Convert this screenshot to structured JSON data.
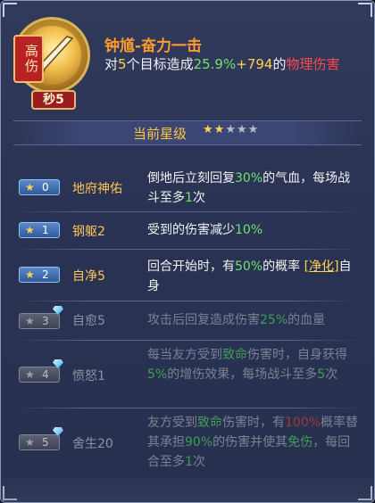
{
  "skill": {
    "type_badge": "高伤",
    "cast_badge": "秒5",
    "title": "钟馗-奋力一击",
    "desc_prefix": "对",
    "target_count": "5",
    "desc_mid": "个目标造成",
    "pct": "25.9%",
    "plus": "+",
    "flat": "794",
    "desc_of": "的",
    "damage_type": "物理伤害"
  },
  "level": {
    "label": "当前星级",
    "stars_filled": 2,
    "stars_total": 5,
    "stars_text_on": "★★",
    "stars_text_off": "★★★"
  },
  "colors": {
    "accent_orange": "#ff9a2e",
    "value_yellow": "#ffd24a",
    "value_green": "#6fe36a",
    "damage_red": "#ff4a4a"
  },
  "rows": [
    {
      "star": "★",
      "num": "0",
      "name": "地府神佑",
      "locked": false,
      "parts": [
        "倒地后立刻回复",
        "30%",
        "的气血，每场战斗至多",
        "1",
        "次"
      ]
    },
    {
      "star": "★",
      "num": "1",
      "name": "钢躯2",
      "locked": false,
      "parts": [
        "受到的伤害减少",
        "10%"
      ]
    },
    {
      "star": "★",
      "num": "2",
      "name": "自净5",
      "locked": false,
      "parts": [
        "回合开始时，有",
        "50%",
        "的概率 ",
        "[净化]",
        "自身"
      ]
    },
    {
      "star": "★",
      "num": "3",
      "name": "自愈5",
      "locked": true,
      "parts": [
        "攻击后回复造成伤害",
        "25%",
        "的血量"
      ]
    },
    {
      "star": "★",
      "num": "4",
      "name": "愤怒1",
      "locked": true,
      "parts": [
        "每当友方受到",
        "致命",
        "伤害时，自身获得",
        "5%",
        "的增伤效果，每场战斗至多",
        "5",
        "次"
      ]
    },
    {
      "star": "★",
      "num": "5",
      "name": "舍生20",
      "locked": true,
      "parts": [
        "友方受到",
        "致命",
        "伤害时，有",
        "100%",
        "概率替其承担",
        "90%",
        "的伤害并使其",
        "免伤",
        "，每回合至多",
        "1",
        "次"
      ]
    }
  ]
}
